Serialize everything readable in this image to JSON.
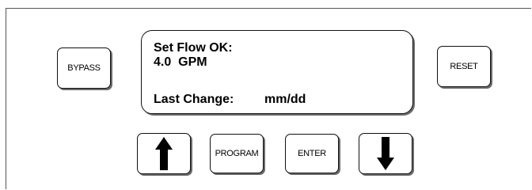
{
  "display": {
    "line1": "Set Flow OK:",
    "line2": "4.0  GPM",
    "last_change_label": "Last Change:",
    "last_change_value": "mm/dd"
  },
  "buttons": {
    "bypass": "BYPASS",
    "reset": "RESET",
    "program": "PROGRAM",
    "enter": "ENTER",
    "up_icon": "up-arrow-icon",
    "down_icon": "down-arrow-icon"
  },
  "colors": {
    "text": "#000000",
    "border": "#111111",
    "shadow": "#6b6b6b",
    "background": "#ffffff"
  }
}
